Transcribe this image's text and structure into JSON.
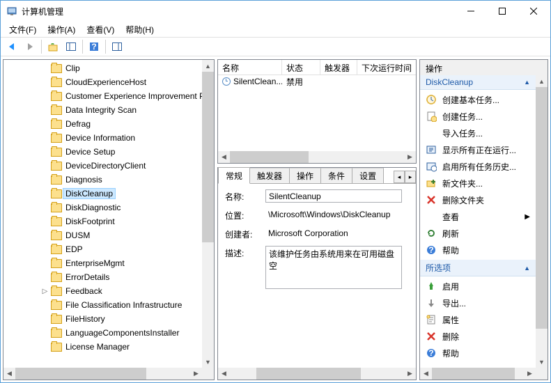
{
  "window": {
    "title": "计算机管理"
  },
  "menus": {
    "file": "文件(F)",
    "action": "操作(A)",
    "view": "查看(V)",
    "help": "帮助(H)"
  },
  "tree": {
    "items": [
      "Clip",
      "CloudExperienceHost",
      "Customer Experience Improvement Program",
      "Data Integrity Scan",
      "Defrag",
      "Device Information",
      "Device Setup",
      "DeviceDirectoryClient",
      "Diagnosis",
      "DiskCleanup",
      "DiskDiagnostic",
      "DiskFootprint",
      "DUSM",
      "EDP",
      "EnterpriseMgmt",
      "ErrorDetails",
      "Feedback",
      "File Classification Infrastructure",
      "FileHistory",
      "LanguageComponentsInstaller",
      "License Manager"
    ],
    "selected_index": 9,
    "expandable_index": 16
  },
  "tasklist": {
    "columns": {
      "name": "名称",
      "status": "状态",
      "triggers": "触发器",
      "nextrun": "下次运行时间"
    },
    "row": {
      "name": "SilentClean...",
      "status": "禁用"
    }
  },
  "detail_tabs": {
    "general": "常规",
    "triggers": "触发器",
    "actions": "操作",
    "conditions": "条件",
    "settings": "设置"
  },
  "detail": {
    "name_label": "名称:",
    "name_value": "SilentCleanup",
    "location_label": "位置:",
    "location_value": "\\Microsoft\\Windows\\DiskCleanup",
    "author_label": "创建者:",
    "author_value": "Microsoft Corporation",
    "desc_label": "描述:",
    "desc_value": "该维护任务由系统用来在可用磁盘空"
  },
  "actions": {
    "pane_title": "操作",
    "group1_title": "DiskCleanup",
    "group1": [
      "创建基本任务...",
      "创建任务...",
      "导入任务...",
      "显示所有正在运行...",
      "启用所有任务历史...",
      "新文件夹...",
      "删除文件夹",
      "查看",
      "刷新",
      "帮助"
    ],
    "group2_title": "所选项",
    "group2": [
      "启用",
      "导出...",
      "属性",
      "删除",
      "帮助"
    ]
  }
}
